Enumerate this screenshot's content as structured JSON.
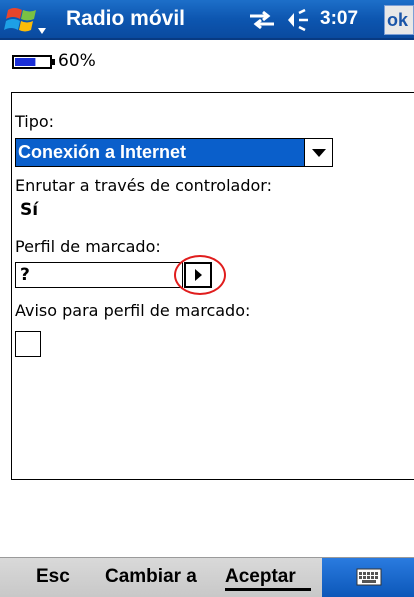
{
  "title_bar": {
    "title": "Radio móvil",
    "clock": "3:07",
    "ok_label": "ok",
    "icons": [
      "windows-start-icon",
      "network-sync-icon",
      "volume-icon"
    ]
  },
  "status": {
    "battery_percent_label": "60%",
    "battery_level": 0.6
  },
  "form": {
    "tipo_label": "Tipo:",
    "tipo_value": "Conexión a Internet",
    "enrutar_label": "Enrutar a través de controlador:",
    "enrutar_value": "Sí",
    "perfil_label": "Perfil de marcado:",
    "perfil_value": "?",
    "aviso_label": "Aviso para perfil de marcado:",
    "aviso_checked": false
  },
  "menu_bar": {
    "esc_label": "Esc",
    "cambiar_label": "Cambiar a",
    "aceptar_label": "Aceptar",
    "keyboard_icon": "keyboard-icon"
  },
  "colors": {
    "title_bar": "#0d56b0",
    "selection": "#0a5fcb",
    "highlight_circle": "#e01d1d",
    "menu_bar": "#d0d0d0"
  }
}
